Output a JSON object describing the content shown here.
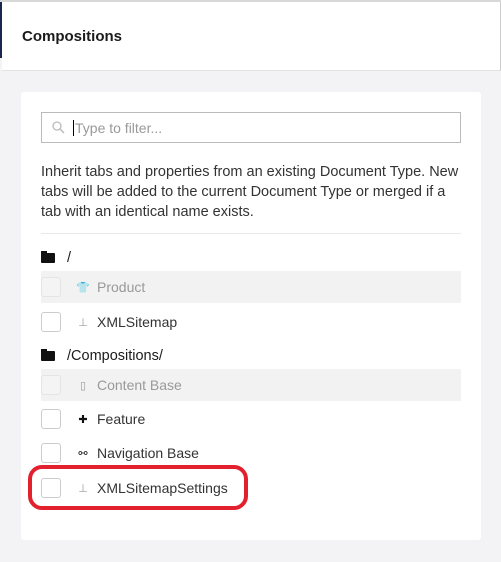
{
  "header": {
    "title": "Compositions"
  },
  "filter": {
    "placeholder": "Type to filter..."
  },
  "description": "Inherit tabs and properties from an existing Document Type. New tabs will be added to the current Document Type or merged if a tab with an identical name exists.",
  "groups": [
    {
      "folder": "/",
      "items": [
        {
          "label": "Product",
          "icon": "shirt-icon",
          "disabled": true
        },
        {
          "label": "XMLSitemap",
          "icon": "sitemap-icon",
          "disabled": false
        }
      ]
    },
    {
      "folder": "/Compositions/",
      "items": [
        {
          "label": "Content Base",
          "icon": "document-icon",
          "disabled": true
        },
        {
          "label": "Feature",
          "icon": "puzzle-icon",
          "disabled": false
        },
        {
          "label": "Navigation Base",
          "icon": "nodes-icon",
          "disabled": false
        },
        {
          "label": "XMLSitemapSettings",
          "icon": "sitemap-icon",
          "disabled": false
        }
      ]
    }
  ],
  "highlight_color": "#e3202d"
}
